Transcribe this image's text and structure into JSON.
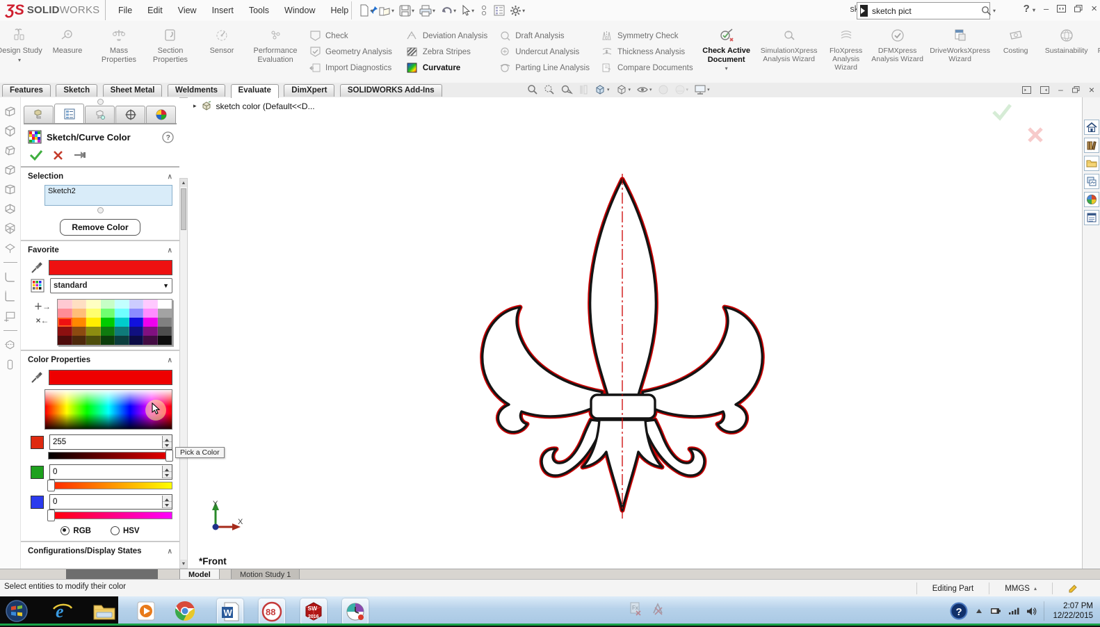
{
  "colors": {
    "accent_red": "#ff0000",
    "selection_blue": "#d9ecf9",
    "logo_red": "#cf1f2f",
    "taskbar_green": "#18a348",
    "current_color": "#ee0000"
  },
  "glyphs": {
    "caret_down": "▾",
    "caret_up": "▴",
    "collapse": "∧",
    "expand_tri": "▸",
    "minimize": "–",
    "close": "×",
    "scroll_up": "▲",
    "scroll_down": "▼",
    "add_fav": "＋→",
    "del_fav": "×←"
  },
  "titlebar": {
    "logo_mark": "ƷS",
    "logo_solid": "SOLID",
    "logo_works": "WORKS",
    "title": "sketch color *",
    "search_value": "sketch pict",
    "help": "?"
  },
  "menu": [
    "File",
    "Edit",
    "View",
    "Insert",
    "Tools",
    "Window",
    "Help"
  ],
  "ribbon": {
    "design_study": "Design Study",
    "buttons": [
      "Measure",
      "Mass Properties",
      "Section Properties",
      "Sensor",
      "Performance Evaluation"
    ],
    "col_check": [
      "Check",
      "Geometry Analysis",
      "Import Diagnostics"
    ],
    "col_surface": [
      "Deviation Analysis",
      "Zebra Stripes",
      "Curvature"
    ],
    "col_draft": [
      "Draft Analysis",
      "Undercut Analysis",
      "Parting Line Analysis"
    ],
    "col_compare": [
      "Symmetry Check",
      "Thickness Analysis",
      "Compare Documents"
    ],
    "check_active": "Check Active Document",
    "wizards": [
      "SimulationXpress Analysis Wizard",
      "FloXpress Analysis Wizard",
      "DFMXpress Analysis Wizard",
      "DriveWorksXpress Wizard",
      "Costing",
      "Sustainability",
      "Part Reviewer"
    ]
  },
  "command_tabs": {
    "items": [
      "Features",
      "Sketch",
      "Sheet Metal",
      "Weldments",
      "Evaluate",
      "DimXpert",
      "SOLIDWORKS Add-Ins"
    ],
    "active": "Evaluate"
  },
  "property_panel": {
    "title": "Sketch/Curve Color",
    "selection": {
      "header": "Selection",
      "selected_item": "Sketch2",
      "remove_button": "Remove Color"
    },
    "favorite": {
      "header": "Favorite",
      "swatch_color": "#ee1111",
      "dropdown_value": "standard",
      "selected_cell": [
        2,
        0
      ],
      "palette_rows": [
        [
          "#ffc9d2",
          "#ffdfc2",
          "#ffffc2",
          "#c6ffc6",
          "#c2ffff",
          "#ccccff",
          "#ffc9ff",
          "#ffffff"
        ],
        [
          "#ff8c96",
          "#ffbe78",
          "#ffff70",
          "#70ff70",
          "#70ffff",
          "#8c8cff",
          "#ff8cff",
          "#a3a3a3"
        ],
        [
          "#ee1111",
          "#ff8800",
          "#ffee00",
          "#00cc00",
          "#00cccc",
          "#1111dd",
          "#ee00ee",
          "#808080"
        ],
        [
          "#8c1010",
          "#8c4a10",
          "#8c8c10",
          "#0f7a0f",
          "#0f7a7a",
          "#101080",
          "#801080",
          "#4d4d4d"
        ],
        [
          "#4d0b0b",
          "#4d280b",
          "#4d4d0b",
          "#0b3d0b",
          "#0b3d3d",
          "#0b0b45",
          "#420b42",
          "#0d0d0d"
        ]
      ]
    },
    "color_properties": {
      "header": "Color Properties",
      "current_color": "#ee0000",
      "tooltip": "Pick a Color",
      "channels": [
        {
          "name": "R",
          "swatch": "#df2a10",
          "value": "255"
        },
        {
          "name": "G",
          "swatch": "#1ea11e",
          "value": "0"
        },
        {
          "name": "B",
          "swatch": "#2b3bee",
          "value": "0"
        }
      ],
      "radio_rgb": "RGB",
      "radio_hsv": "HSV"
    },
    "configurations_header": "Configurations/Display States"
  },
  "viewport": {
    "tree_item": "sketch color  (Default<<D...",
    "front_label": "*Front",
    "axis_x": "X",
    "axis_y": "Y",
    "sketch_name": "Sketch2"
  },
  "model_tabs": {
    "model": "Model",
    "motion": "Motion Study 1"
  },
  "status_bar": {
    "message": "Select entities to modify their color",
    "editing": "Editing Part",
    "units": "MMGS"
  },
  "taskbar": {
    "glyphs": {
      "ie": "e",
      "word": "W",
      "snagit": "88",
      "sw": "SW",
      "sw_year": "2016",
      "tray_help": "?"
    },
    "clock_time": "2:07 PM",
    "clock_date": "12/22/2015"
  }
}
